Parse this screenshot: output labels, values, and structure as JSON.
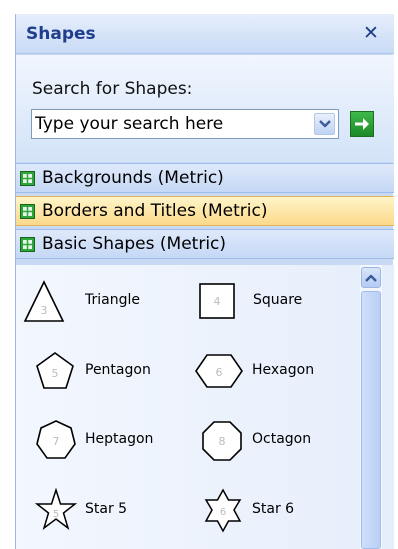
{
  "header": {
    "title": "Shapes",
    "close_glyph": "✕"
  },
  "search": {
    "label": "Search for Shapes:",
    "placeholder": "Type your search here",
    "dropdown_icon": "chevron-down-icon",
    "go_icon": "arrow-right-icon",
    "go_color": "#2aa336"
  },
  "categories": [
    {
      "label": "Backgrounds (Metric)",
      "active": false
    },
    {
      "label": "Borders and Titles (Metric)",
      "active": true
    },
    {
      "label": "Basic Shapes (Metric)",
      "active": false
    }
  ],
  "shapes": [
    {
      "label": "Triangle",
      "number": "3",
      "icon": "triangle-icon"
    },
    {
      "label": "Square",
      "number": "4",
      "icon": "square-icon"
    },
    {
      "label": "Pentagon",
      "number": "5",
      "icon": "pentagon-icon"
    },
    {
      "label": "Hexagon",
      "number": "6",
      "icon": "hexagon-icon"
    },
    {
      "label": "Heptagon",
      "number": "7",
      "icon": "heptagon-icon"
    },
    {
      "label": "Octagon",
      "number": "8",
      "icon": "octagon-icon"
    },
    {
      "label": "Star 5",
      "number": "5",
      "icon": "star-5-icon"
    },
    {
      "label": "Star 6",
      "number": "6",
      "icon": "star-6-icon"
    }
  ],
  "colors": {
    "title": "#1f3f8c",
    "category_active": "#fbd98a",
    "panel": "#c8daf3"
  }
}
